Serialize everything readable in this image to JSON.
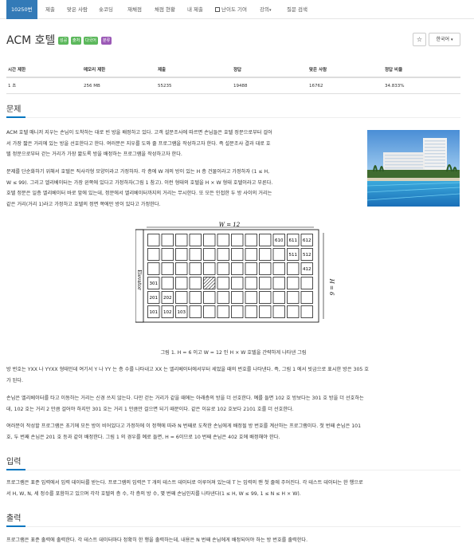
{
  "nav": {
    "tabs": [
      "10250번",
      "제출",
      "맞은 사람",
      "숏코딩",
      "재채점",
      "채점 현황",
      "내 제출",
      "난이도 기여",
      "강의",
      "질문 검색"
    ],
    "lecture_caret": "▾"
  },
  "problem": {
    "title": "ACM 호텔",
    "labels": [
      {
        "text": "성공",
        "color": "#5cb85c"
      },
      {
        "text": "출처",
        "color": "#5cb85c"
      },
      {
        "text": "다국어",
        "color": "#5cb85c"
      },
      {
        "text": "분류",
        "color": "#9b59b6"
      }
    ],
    "star": "☆",
    "language": "한국어",
    "language_caret": "▾"
  },
  "stats": {
    "headers": [
      "시간 제한",
      "메모리 제한",
      "제출",
      "정답",
      "맞은 사람",
      "정답 비율"
    ],
    "values": [
      "1 초",
      "256 MB",
      "55235",
      "19488",
      "16762",
      "34.833%"
    ]
  },
  "sections": {
    "problem_heading": "문제",
    "input_heading": "입력",
    "output_heading": "출력"
  },
  "problem_text": [
    [
      "ACM 호텔 매니저 지우는 손님이 도착하는 대로 빈 방을 배정하고 있다. 고객 설문조사에 따르면 손님들은 호텔 정문으로부터 걸어",
      "서 가장 짧은 거리에 있는 방을 선호한다고 한다. 여러분은 지우를 도와 줄 프로그램을 작성하고자 한다. 즉 설문조사 결과 대로 호",
      "텔 정문으로부터 걷는 거리가 가장 짧도록 방을 배정하는 프로그램을 작성하고자 한다."
    ],
    [
      "문제를 단순화하기 위해서 호텔은 직사각형 모양이라고 가정하자. 각 층에 W 개의 방이 있는 H 층 건물이라고 가정하자 (1 ≤ H,",
      "W ≤ 99). 그리고 엘리베이터는 가장 왼쪽에 있다고 가정하자(그림 1 참고). 이런 형태의 호텔을 H × W 형태 호텔이라고 부른다.",
      "호텔 정문은 일층 엘리베이터 바로 앞에 있는데, 정문에서 엘리베이터까지의 거리는 무시한다. 또 모든 인접한 두 방 사이의 거리는",
      "같은 거리(거리 1)라고 가정하고 호텔의 정면 쪽에만 방이 있다고 가정한다."
    ],
    [
      "방 번호는 YXX 나 YYXX 형태인데 여기서 Y 나 YY 는 층 수를 나타내고 XX 는 엘리베이터에서부터 세었을 때의 번호를 나타낸다. 즉, 그림 1 에서 빗금으로 표시한 방은 305 호",
      "가 된다."
    ],
    [
      "손님은 엘리베이터를 타고 이동하는 거리는 신경 쓰지 않는다. 다만 걷는 거리가 같을 때에는 아래층의 방을 더 선호한다. 예를 들면 102 호 방보다는 301 호 방을 더 선호하는",
      "데, 102 호는 거리 2 만큼 걸어야 하지만 301 호는 거리 1 만큼만 걸으면 되기 때문이다. 같은 이유로 102 호보다 2101 호를 더 선호한다."
    ],
    [
      "여러분이 작성할 프로그램은 초기에 모든 방이 비어있다고 가정하에 이 정책에 따라 N 번째로 도착한 손님에게 배정될 방 번호를 계산하는 프로그램이다. 첫 번째 손님은 101",
      "호, 두 번째 손님은 201 호 등과 같이 배정한다. 그림 1 의 경우를 예로 들면, H = 6이므로 10 번째 손님은 402 호에 배정해야 한다."
    ]
  ],
  "figure": {
    "width_label": "W = 12",
    "height_label": "H = 6",
    "elevator_label": "Elevator",
    "room_labels": [
      {
        "row": 6,
        "col": 10,
        "text": "610"
      },
      {
        "row": 6,
        "col": 11,
        "text": "611"
      },
      {
        "row": 6,
        "col": 12,
        "text": "612"
      },
      {
        "row": 5,
        "col": 11,
        "text": "511"
      },
      {
        "row": 5,
        "col": 12,
        "text": "512"
      },
      {
        "row": 4,
        "col": 12,
        "text": "412"
      },
      {
        "row": 3,
        "col": 1,
        "text": "301"
      },
      {
        "row": 2,
        "col": 1,
        "text": "201"
      },
      {
        "row": 2,
        "col": 2,
        "text": "202"
      },
      {
        "row": 1,
        "col": 1,
        "text": "101"
      },
      {
        "row": 1,
        "col": 2,
        "text": "102"
      },
      {
        "row": 1,
        "col": 3,
        "text": "103"
      }
    ],
    "hatched_room": {
      "row": 3,
      "col": 5
    },
    "caption": "그림 1. H = 6 이고 W = 12 인 H × W 호텔을 간략하게 나타낸 그림"
  },
  "input_text": [
    "프로그램은 표준 입력에서 입력 데이터를 받는다. 프로그램의 입력은 T 개의 테스트 데이터로 이루어져 있는데 T 는 입력의 맨 첫 줄에 주어진다. 각 테스트 데이터는 한 행으로",
    "서 H, W, N, 세 정수를 포함하고 있으며 각각 호텔의 층 수, 각 층의 방 수, 몇 번째 손님인지를 나타낸다(1 ≤ H, W ≤ 99, 1 ≤ N ≤ H × W)."
  ],
  "output_text": [
    "프로그램은 표준 출력에 출력한다. 각 테스트 데이터마다 정확히 한 행을 출력하는데, 내용은 N 번째 손님에게 배정되어야 하는 방 번호를 출력한다."
  ]
}
